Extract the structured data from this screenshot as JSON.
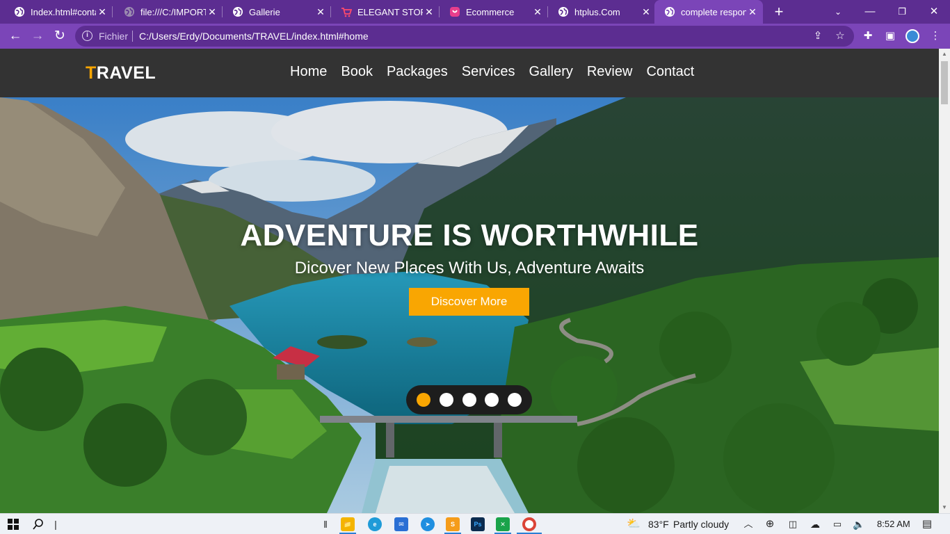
{
  "browser": {
    "tabs": [
      {
        "title": "Index.html#conta",
        "active": false
      },
      {
        "title": "file:///C:/IMPORT",
        "active": false
      },
      {
        "title": "Gallerie",
        "active": false
      },
      {
        "title": "ELEGANT STORE",
        "active": false
      },
      {
        "title": "Ecommerce",
        "active": false
      },
      {
        "title": "htplus.Com",
        "active": false
      },
      {
        "title": "complete respon",
        "active": true
      }
    ],
    "new_tab_symbol": "+",
    "address": {
      "scheme_label": "Fichier",
      "url": "C:/Users/Erdy/Documents/TRAVEL/index.html#home"
    },
    "colors": {
      "frame": "#5c2d91",
      "active_tab": "#7b45b8"
    }
  },
  "site": {
    "logo": {
      "accent": "T",
      "rest": "RAVEL"
    },
    "nav": [
      "Home",
      "Book",
      "Packages",
      "Services",
      "Gallery",
      "Review",
      "Contact"
    ],
    "colors": {
      "header_bg": "#333333",
      "accent": "#f9a602"
    }
  },
  "hero": {
    "title": "ADVENTURE IS WORTHWHILE",
    "subtitle": "Dicover New Places With Us, Adventure Awaits",
    "button_label": "Discover More",
    "slides_count": 5,
    "active_slide": 1
  },
  "taskbar": {
    "weather": {
      "temp": "83°F",
      "condition": "Partly cloudy"
    },
    "time": "8:52 AM"
  }
}
